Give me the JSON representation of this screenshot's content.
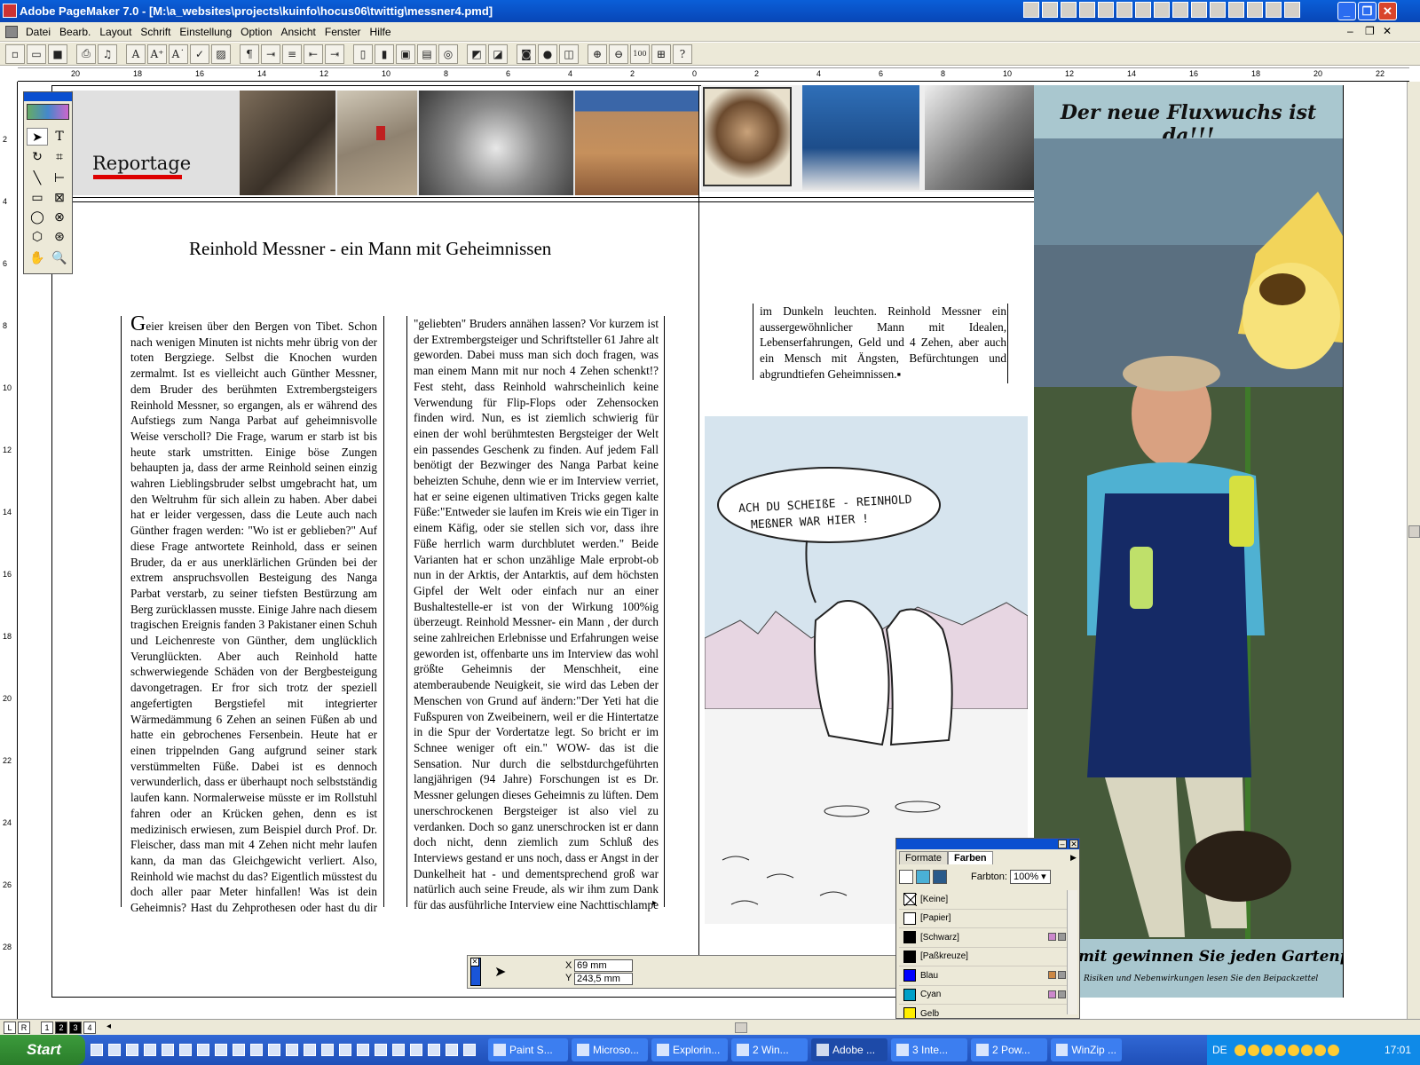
{
  "window": {
    "title": "Adobe PageMaker 7.0 - [M:\\a_websites\\projects\\kuinfo\\hocus06\\twittig\\messner4.pmd]"
  },
  "menu": [
    "Datei",
    "Bearb.",
    "Layout",
    "Schrift",
    "Einstellung",
    "Option",
    "Ansicht",
    "Fenster",
    "Hilfe"
  ],
  "ruler": {
    "h": [
      "20",
      "18",
      "16",
      "14",
      "12",
      "10",
      "8",
      "6",
      "4",
      "2",
      "0",
      "2",
      "4",
      "6",
      "8",
      "10",
      "12",
      "14",
      "16",
      "18",
      "20",
      "22"
    ],
    "v": [
      "2",
      "4",
      "6",
      "8",
      "10",
      "12",
      "14",
      "16",
      "18",
      "20",
      "22",
      "24",
      "26",
      "28"
    ]
  },
  "document": {
    "section": "Reportage",
    "headline": "Reinhold Messner - ein Mann mit Geheimnissen",
    "col1_dropcap": "G",
    "col1": "eier kreisen über den Bergen von Tibet. Schon nach wenigen Minuten ist nichts mehr übrig von der toten Bergziege. Selbst die Knochen wurden zermalmt. Ist es vielleicht auch Günther Messner, dem Bruder des berühmten Extrembergsteigers Reinhold Messner, so ergangen, als er während des Aufstiegs zum Nanga Parbat auf geheimnisvolle Weise verscholl? Die Frage, warum er starb ist bis heute stark umstritten. Einige böse Zungen behaupten ja, dass der arme Reinhold seinen einzig wahren Lieblingsbruder selbst umgebracht hat, um den Weltruhm für sich allein zu haben. Aber dabei hat er leider vergessen, dass die Leute auch nach Günther fragen werden: \"Wo ist er geblieben?\" Auf diese Frage antwortete Reinhold, dass er seinen Bruder, da er aus unerklärlichen Gründen bei der extrem anspruchsvollen Besteigung des Nanga Parbat verstarb, zu seiner tiefsten Bestürzung am Berg zurücklassen musste. Einige Jahre nach diesem tragischen Ereignis fanden 3 Pakistaner einen Schuh und Leichenreste von Günther, dem unglücklich Verunglückten. Aber auch Reinhold hatte schwerwiegende Schäden von der Bergbesteigung davongetragen. Er fror sich trotz der speziell angefertigten Bergstiefel mit integrierter Wärmedämmung 6 Zehen an seinen Füßen ab und hatte ein gebrochenes Fersenbein. Heute hat er einen trippelnden Gang aufgrund seiner stark verstümmelten Füße. Dabei ist es dennoch verwunderlich, dass er überhaupt noch selbstständig laufen kann. Normalerweise müsste er im Rollstuhl fahren oder an Krücken gehen, denn es ist medizinisch erwiesen, zum Beispiel durch Prof. Dr. Fleischer, dass man mit 4 Zehen nicht mehr laufen kann, da man das Gleichgewicht verliert. Also, Reinhold wie machst du das? Eigentlich müsstest du doch aller paar Meter hinfallen! Was ist dein Geheimnis? Hast du Zehprothesen oder hast du dir vielleicht die Zehen von dem übriggebliebenen Fuß deines",
    "col2": "\"geliebten\" Bruders annähen lassen? Vor kurzem ist der Extrembergsteiger und Schriftsteller 61 Jahre alt geworden. Dabei muss man sich doch fragen, was man einem Mann mit nur noch 4 Zehen schenkt!? Fest steht, dass Reinhold wahrscheinlich keine Verwendung für Flip-Flops oder Zehensocken finden wird. Nun, es ist ziemlich schwierig für einen der wohl berühmtesten Bergsteiger der Welt ein passendes Geschenk zu finden. Auf jedem Fall benötigt der Bezwinger des Nanga Parbat keine beheizten Schuhe, denn wie er im Interview verriet, hat er seine eigenen ultimativen Tricks gegen kalte Füße:\"Entweder sie laufen im Kreis wie ein Tiger in einem Käfig, oder sie stellen sich vor, dass ihre Füße herrlich warm durchblutet werden.\" Beide Varianten hat er schon unzählige Male erprobt-ob nun in der Arktis, der Antarktis, auf dem höchsten Gipfel der Welt oder einfach nur an einer Bushaltestelle-er ist von der Wirkung 100%ig überzeugt. Reinhold Messner- ein Mann , der durch seine zahlreichen Erlebnisse und Erfahrungen weise geworden ist, offenbarte uns im Interview das wohl größte Geheimnis der Menschheit, eine atemberaubende Neuigkeit, sie wird das Leben der Menschen von Grund auf ändern:\"Der Yeti hat die Fußspuren von Zweibeinern, weil er die Hintertatze in die Spur der Vordertatze legt. So bricht er im Schnee weniger oft ein.\" WOW- das ist die Sensation. Nur durch die selbstdurchgeführten langjährigen (94 Jahre) Forschungen ist es Dr. Messner gelungen dieses Geheimnis zu lüften. Dem unerschrockenen Bergsteiger ist also viel zu verdanken. Doch so ganz unerschrocken ist er dann doch nicht, denn ziemlich zum Schluß des Interviews gestand er uns noch, dass er Angst in der Dunkelheit hat - und dementsprechend groß war natürlich auch seine Freude, als wir ihm zum Dank für das ausführliche Interview eine Nachttischlampe und Sticker schenkten, welche",
    "col3": "im Dunkeln leuchten. Reinhold Messner ein aussergewöhnlicher Mann mit Idealen, Lebenserfahrungen, Geld und 4 Zehen, aber auch ein Mensch mit Ängsten, Befürchtungen und abgrundtiefen Geheimnissen.▪",
    "cartoon_speech_line1": "ACH DU SCHEIßE - REINHOLD",
    "cartoon_speech_line2": "MEßNER WAR HIER !",
    "poster_title": "Der neue Fluxwuchs ist da!!!",
    "poster_slogan": "mit gewinnen Sie jeden Gartenpreis...\"",
    "poster_small": "Risiken und Nebenwirkungen lesen Sie den Beipackzettel"
  },
  "control_palette": {
    "x_label": "X",
    "x_value": "69 mm",
    "y_label": "Y",
    "y_value": "243,5 mm"
  },
  "color_palette": {
    "tabs": [
      "Formate",
      "Farben"
    ],
    "tint_label": "Farbton:",
    "tint_value": "100%",
    "swatches": [
      {
        "name": "[Keine]",
        "color": "#ffffff"
      },
      {
        "name": "[Papier]",
        "color": "#ffffff"
      },
      {
        "name": "[Schwarz]",
        "color": "#000000"
      },
      {
        "name": "[Paßkreuze]",
        "color": "#000000"
      },
      {
        "name": "Blau",
        "color": "#0000ff"
      },
      {
        "name": "Cyan",
        "color": "#00a0c8"
      },
      {
        "name": "Gelb",
        "color": "#ffee00"
      }
    ]
  },
  "pages": {
    "left": "L",
    "right": "R",
    "nums": [
      "1",
      "2",
      "3",
      "4"
    ]
  },
  "taskbar": {
    "start": "Start",
    "tasks": [
      "Paint S...",
      "Microso...",
      "Explorin...",
      "2 Win...",
      "Adobe ...",
      "3 Inte...",
      "2 Pow...",
      "WinZip ..."
    ],
    "lang": "DE",
    "clock": "17:01"
  }
}
